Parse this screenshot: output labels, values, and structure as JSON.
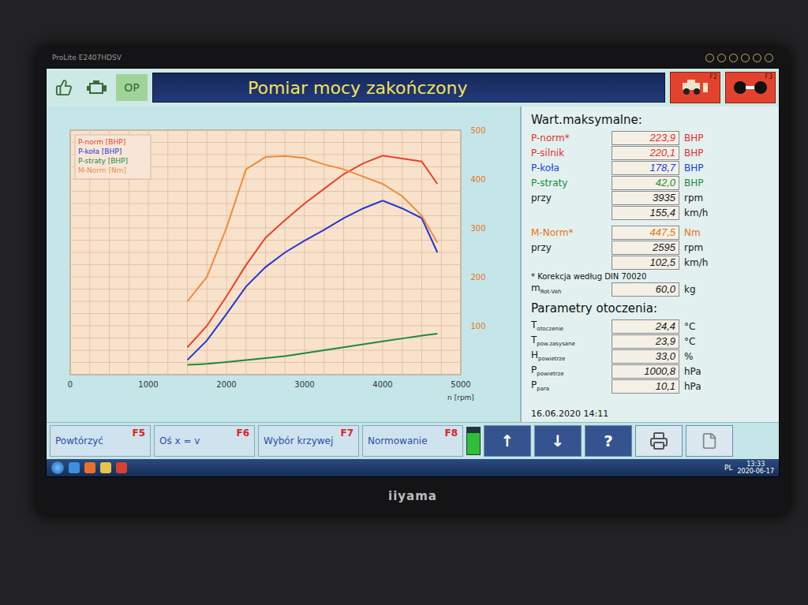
{
  "monitor": {
    "model": "ProLite E2407HDSV",
    "brand": "iiyama"
  },
  "header": {
    "status": "OP",
    "title": "Pomiar mocy zakończony",
    "keys": [
      {
        "label": "F2",
        "kind": "car"
      },
      {
        "label": "F3",
        "kind": "roller"
      }
    ]
  },
  "chart": {
    "x_ticks": [
      "0",
      "1000",
      "2000",
      "3000",
      "4000",
      "5000"
    ],
    "x_label": "n [rpm]",
    "torque_ticks": [
      "100",
      "200",
      "300",
      "400",
      "500"
    ],
    "rpm": [
      1500,
      1750,
      2000,
      2250,
      2500,
      2750,
      3000,
      3250,
      3500,
      3750,
      4000,
      4250,
      4500,
      4700
    ],
    "series": [
      {
        "name": "P-norm [BHP]",
        "axis": "power",
        "color": "#e8432a",
        "values": [
          28,
          50,
          80,
          112,
          140,
          158,
          175,
          190,
          205,
          216,
          224,
          221,
          218,
          195
        ]
      },
      {
        "name": "P-koła [BHP]",
        "axis": "power",
        "color": "#2438d0",
        "values": [
          15,
          35,
          62,
          90,
          110,
          125,
          137,
          148,
          160,
          170,
          178,
          170,
          160,
          125
        ]
      },
      {
        "name": "P-straty [BHP]",
        "axis": "power",
        "color": "#1f8a3a",
        "values": [
          10,
          11,
          13,
          15,
          17,
          19,
          22,
          25,
          28,
          31,
          34,
          37,
          40,
          42
        ]
      },
      {
        "name": "M-Norm [Nm]",
        "axis": "torque",
        "color": "#f08a3a",
        "values": [
          150,
          200,
          300,
          420,
          445,
          447,
          443,
          430,
          420,
          405,
          390,
          365,
          325,
          270
        ]
      }
    ]
  },
  "maxima": {
    "title": "Wart.maksymalne:",
    "rows": [
      {
        "label": "P-norm*",
        "value": "223,9",
        "unit": "BHP",
        "color": "#e0322a"
      },
      {
        "label": "P-silnik",
        "value": "220,1",
        "unit": "BHP",
        "color": "#e0322a"
      },
      {
        "label": "P-koła",
        "value": "178,7",
        "unit": "BHP",
        "color": "#1a3fd6"
      },
      {
        "label": "P-straty",
        "value": "42,0",
        "unit": "BHP",
        "color": "#1c8a3a"
      },
      {
        "label": "przy",
        "value": "3935",
        "unit": "rpm",
        "color": "#1a1a1a"
      },
      {
        "label": "",
        "value": "155,4",
        "unit": "km/h",
        "color": "#1a1a1a"
      }
    ],
    "torque_rows": [
      {
        "label": "M-Norm*",
        "value": "447,5",
        "unit": "Nm",
        "color": "#e8731a"
      },
      {
        "label": "przy",
        "value": "2595",
        "unit": "rpm",
        "color": "#1a1a1a"
      },
      {
        "label": "",
        "value": "102,5",
        "unit": "km/h",
        "color": "#1a1a1a"
      }
    ],
    "note": "* Korekcja według DIN 70020",
    "mass": {
      "label": "m",
      "sub": "Rot-Veh",
      "value": "60,0",
      "unit": "kg"
    }
  },
  "ambient": {
    "title": "Parametry otoczenia:",
    "rows": [
      {
        "label": "T",
        "sub": "otoczenie",
        "value": "24,4",
        "unit": "°C"
      },
      {
        "label": "T",
        "sub": "pow.zasysane",
        "value": "23,9",
        "unit": "°C"
      },
      {
        "label": "H",
        "sub": "powietrze",
        "value": "33,0",
        "unit": "%"
      },
      {
        "label": "P",
        "sub": "powietrze",
        "value": "1000,8",
        "unit": "hPa"
      },
      {
        "label": "P",
        "sub": "para",
        "value": "10,1",
        "unit": "hPa"
      }
    ]
  },
  "date": "16.06.2020 14:11",
  "buttons": [
    {
      "label": "Powtórzyć",
      "key": "F5"
    },
    {
      "label": "Oś x = v",
      "key": "F6"
    },
    {
      "label": "Wybór krzywej",
      "key": "F7"
    },
    {
      "label": "Normowanie",
      "key": "F8"
    }
  ],
  "tools": [
    {
      "kind": "battery",
      "label": "",
      "level": 0.8
    },
    {
      "kind": "arrow",
      "label": "↑",
      "level": 0
    },
    {
      "kind": "arrow",
      "label": "↓",
      "level": 0
    },
    {
      "kind": "help",
      "label": "?",
      "level": 0
    },
    {
      "kind": "print",
      "label": "",
      "level": 0
    },
    {
      "kind": "page",
      "label": "",
      "level": 0
    }
  ],
  "taskbar": {
    "lang": "PL",
    "time": "13:33",
    "date": "2020-06-17"
  }
}
